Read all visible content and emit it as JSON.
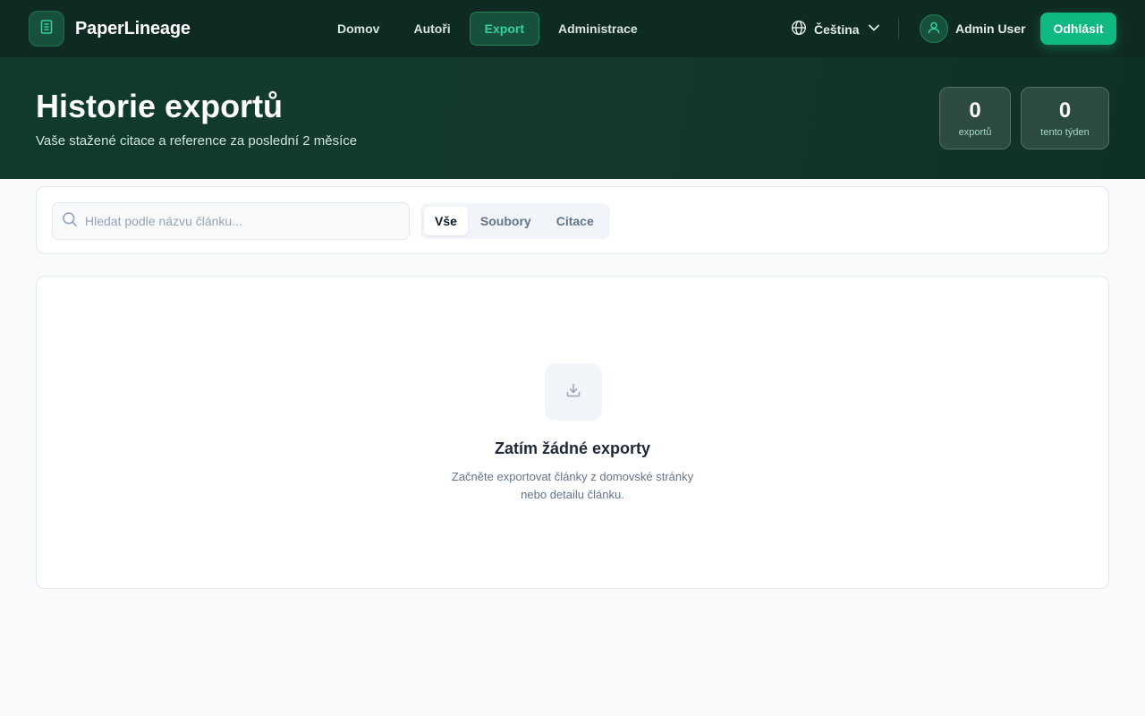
{
  "app": {
    "brand": "PaperLineage"
  },
  "nav": {
    "items": [
      {
        "label": "Domov",
        "active": false
      },
      {
        "label": "Autoři",
        "active": false
      },
      {
        "label": "Export",
        "active": true
      },
      {
        "label": "Administrace",
        "active": false
      }
    ]
  },
  "header": {
    "language": "Čeština",
    "user_name": "Admin User",
    "logout_label": "Odhlásit"
  },
  "hero": {
    "title": "Historie exportů",
    "subtitle": "Vaše stažené citace a reference za poslední 2 měsíce",
    "stats": [
      {
        "value": "0",
        "label": "exportů"
      },
      {
        "value": "0",
        "label": "tento týden"
      }
    ]
  },
  "filters": {
    "search_placeholder": "Hledat podle názvu článku...",
    "search_value": "",
    "tabs": [
      {
        "label": "Vše",
        "active": true
      },
      {
        "label": "Soubory",
        "active": false
      },
      {
        "label": "Citace",
        "active": false
      }
    ]
  },
  "empty_state": {
    "title": "Zatím žádné exporty",
    "text": "Začněte exportovat články z domovské stránky nebo detailu článku."
  },
  "colors": {
    "topbar": "#0f2a22",
    "accent": "#10b981",
    "accent_text": "#34d399",
    "background": "#f8fafc"
  }
}
